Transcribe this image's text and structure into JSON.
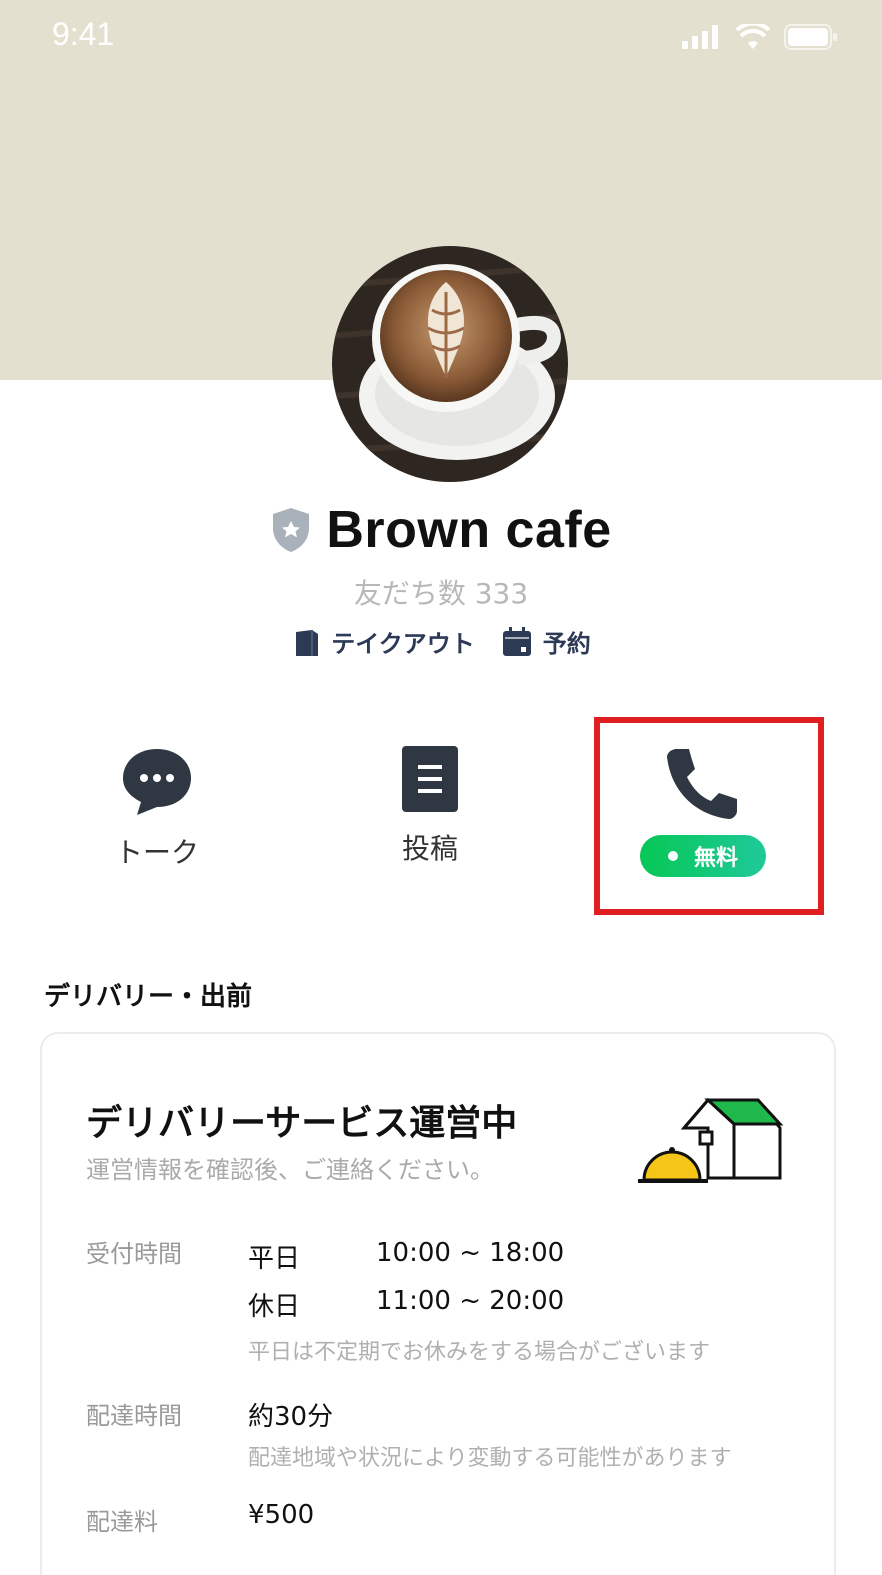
{
  "status": {
    "time": "9:41"
  },
  "profile": {
    "name": "Brown cafe",
    "friends": "友だち数 333",
    "tags": [
      "テイクアウト",
      "予約"
    ]
  },
  "actions": {
    "talk": "トーク",
    "post": "投稿",
    "call_badge": "無料"
  },
  "section": {
    "title": "デリバリー・出前"
  },
  "delivery": {
    "title": "デリバリーサービス運営中",
    "subtitle": "運営情報を確認後、ご連絡ください。",
    "hours_label": "受付時間",
    "weekday": "平日",
    "weekday_time": "10:00 ~ 18:00",
    "holiday": "休日",
    "holiday_time": "11:00 ~ 20:00",
    "hours_note": "平日は不定期でお休みをする場合がございます",
    "delivery_time_label": "配達時間",
    "delivery_time": "約30分",
    "delivery_time_note": "配達地域や状況により変動する可能性があります",
    "fee_label": "配達料",
    "fee": "¥500"
  },
  "colors": {
    "header_bg": "#e4e0d0",
    "accent_green": "#06c755",
    "highlight_red": "#e02020",
    "tag_navy": "#2d3a55"
  }
}
